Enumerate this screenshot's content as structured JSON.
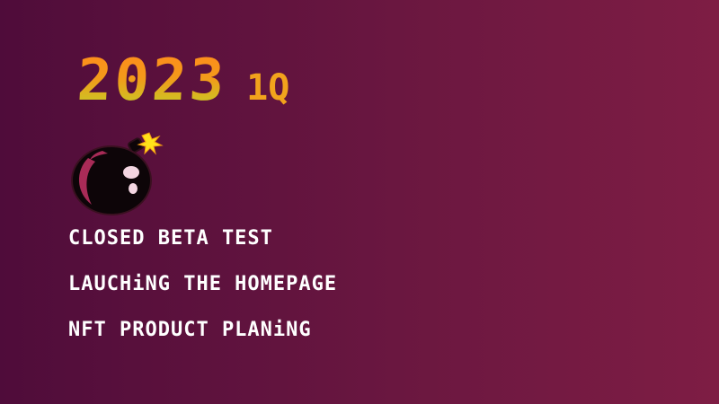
{
  "heading": {
    "year": "2023",
    "quarter": "1Q"
  },
  "bomb": {
    "icon": "bomb-icon",
    "body_color": "#0d0508",
    "accent_color": "#a82b57",
    "spark_color": "#ffe21a"
  },
  "milestones": [
    "CLOSED BETA TEST",
    "LAUCHiNG THE HOMEPAGE",
    "NFT PRODUCT PLANiNG"
  ]
}
